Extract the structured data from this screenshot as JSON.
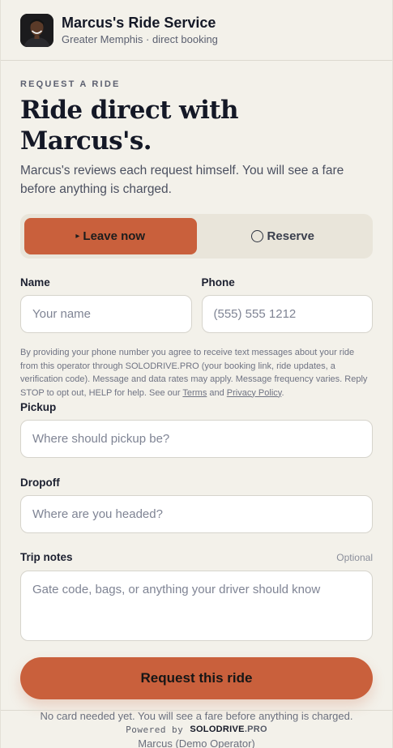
{
  "header": {
    "avatar": "operator-photo",
    "title": "Marcus's Ride Service",
    "subtitle": "Greater Memphis · direct booking"
  },
  "hero": {
    "eyebrow": "REQUEST A RIDE",
    "headline": "Ride direct with Marcus's.",
    "lede": "Marcus's reviews each request himself. You will see a fare before anything is charged."
  },
  "mode": {
    "options": [
      {
        "label": "Leave now",
        "glyph": "▸",
        "selected": true
      },
      {
        "label": "Reserve",
        "glyph": "circle-icon",
        "selected": false
      }
    ]
  },
  "form": {
    "name": {
      "label": "Name",
      "placeholder": "Your name",
      "value": ""
    },
    "phone": {
      "label": "Phone",
      "placeholder": "(555) 555 1212",
      "value": ""
    },
    "consent": {
      "text": "By providing your phone number you agree to receive text messages about your ride from this operator through SOLODRIVE.PRO (your booking link, ride updates, a verification code). Message and data rates may apply. Message frequency varies. Reply STOP to opt out, HELP for help. See our ",
      "terms": "Terms",
      "and": " and ",
      "privacy": "Privacy Policy",
      "end": "."
    },
    "pickup": {
      "label": "Pickup",
      "placeholder": "Where should pickup be?",
      "value": ""
    },
    "dropoff": {
      "label": "Dropoff",
      "placeholder": "Where are you headed?",
      "value": ""
    },
    "notes": {
      "label": "Trip notes",
      "optional": "Optional",
      "placeholder": "Gate code, bags, or anything your driver should know",
      "value": ""
    },
    "submit": "Request this ride",
    "note": "No card needed yet. You will see a fare before anything is charged.",
    "operator": "Marcus (Demo Operator)"
  },
  "footer": {
    "powered": "Powered by",
    "brand": "SOLODRIVE",
    "brand_suffix": ".PRO"
  },
  "colors": {
    "accent": "#c9603c",
    "background": "#f3f1ea",
    "toggle_track": "#e9e5da",
    "text": "#141826"
  }
}
